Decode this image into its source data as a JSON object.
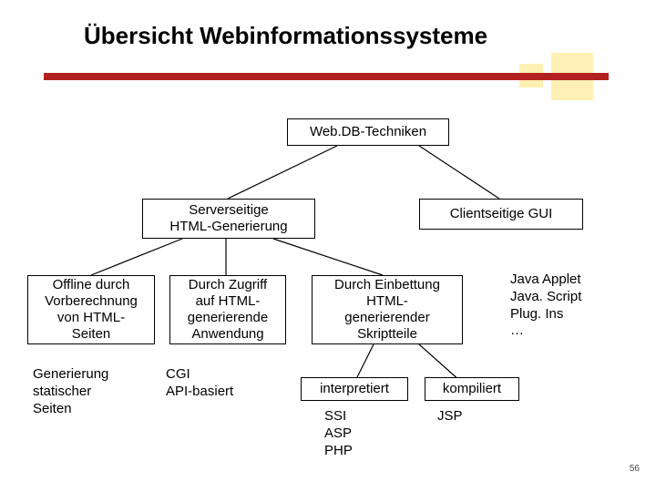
{
  "title": "Übersicht Webinformationssysteme",
  "root": "Web.DB-Techniken",
  "level2": {
    "server": "Serverseitige\nHTML-Generierung",
    "client": "Clientseitige GUI"
  },
  "level3": {
    "offline": "Offline durch\nVorberechnung\nvon HTML-\nSeiten",
    "zugriff": "Durch Zugriff\nauf HTML-\ngenerierende\nAnwendung",
    "einbettung": "Durch Einbettung\nHTML-\ngenerierender\nSkriptteile"
  },
  "leaves": {
    "static": "Generierung\nstatischer\nSeiten",
    "cgi": "CGI\nAPI-basiert",
    "interpreted": "interpretiert",
    "compiled": "kompiliert",
    "ssi": "SSI\nASP\nPHP",
    "jsp": "JSP"
  },
  "clientlist": "Java Applet\nJava. Script\nPlug. Ins\n…",
  "pagenum": "56"
}
